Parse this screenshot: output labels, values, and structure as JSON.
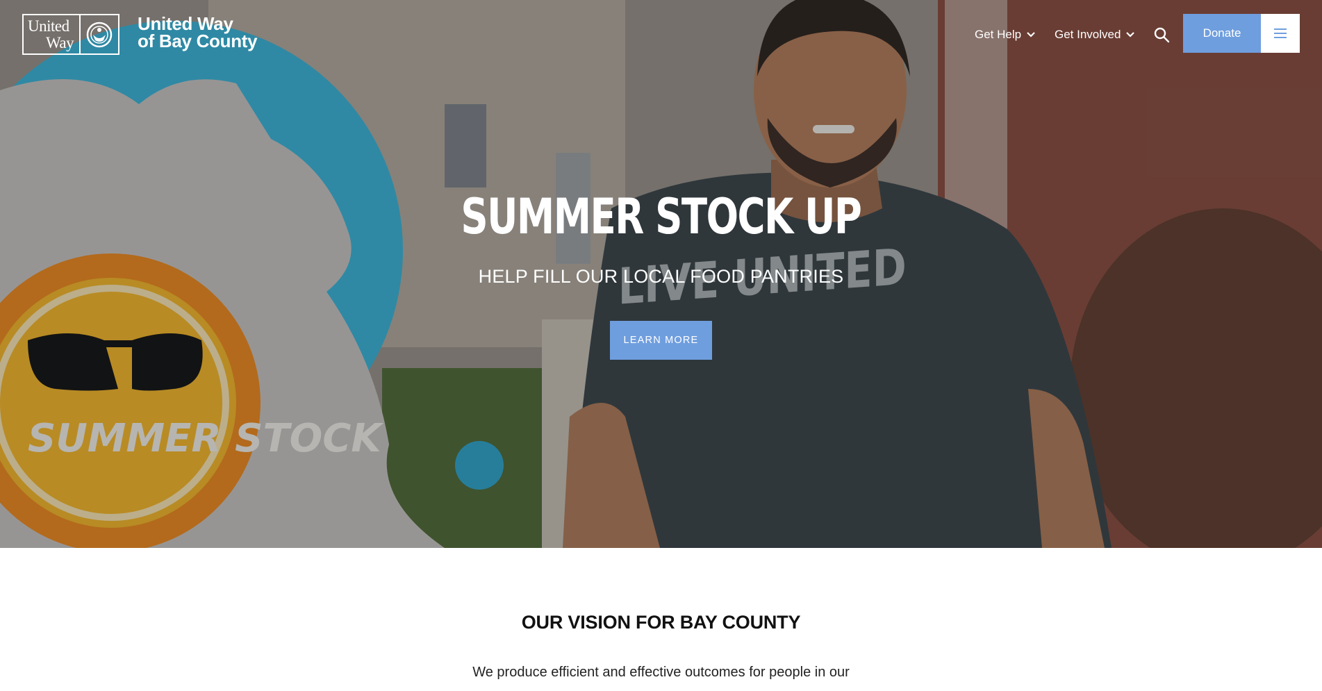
{
  "brand": {
    "logo_line1": "United",
    "logo_line2": "Way",
    "org_line1": "United Way",
    "org_line2": "of Bay County"
  },
  "nav": {
    "items": [
      {
        "label": "Get Help",
        "icon": "chevron-down-icon"
      },
      {
        "label": "Get Involved",
        "icon": "chevron-down-icon"
      }
    ],
    "search_icon": "search-icon",
    "donate_label": "Donate",
    "menu_icon": "hamburger-menu-icon"
  },
  "hero": {
    "title": "SUMMER STOCK UP",
    "subtitle": "HELP FILL OUR LOCAL FOOD PANTRIES",
    "cta_label": "LEARN MORE",
    "shirt_text": "LIVE UNITED",
    "sign_text": "SUMMER STOCK"
  },
  "vision": {
    "title": "OUR VISION FOR BAY COUNTY",
    "text": "We produce efficient and effective outcomes for people in our"
  },
  "colors": {
    "accent": "#6f9ede",
    "text_dark": "#111111",
    "background": "#ffffff"
  }
}
